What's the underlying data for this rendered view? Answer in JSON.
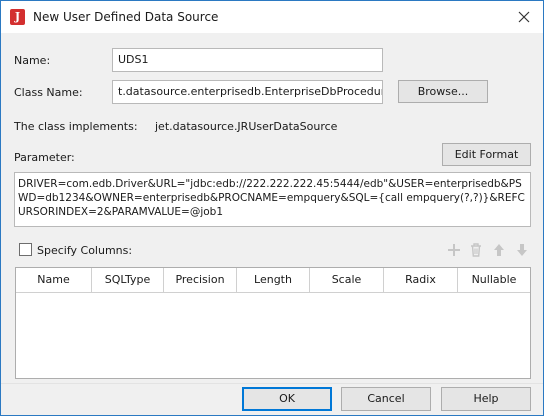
{
  "window": {
    "title": "New User Defined Data Source",
    "icon": "report-app-icon",
    "icon_letter": "J"
  },
  "form": {
    "name_label": "Name:",
    "name_value": "UDS1",
    "class_name_label": "Class Name:",
    "class_name_value": "t.datasource.enterprisedb.EnterpriseDbProcedureUDS",
    "browse_label": "Browse...",
    "implements_label": "The class implements:",
    "implements_value": "jet.datasource.JRUserDataSource",
    "parameter_label": "Parameter:",
    "edit_format_label": "Edit Format",
    "parameter_value": "DRIVER=com.edb.Driver&URL=\"jdbc:edb://222.222.222.45:5444/edb\"&USER=enterprisedb&PSWD=db1234&OWNER=enterprisedb&PROCNAME=empquery&SQL={call empquery(?,?)}&REFCURSORINDEX=2&PARAMVALUE=@job1",
    "specify_columns_label": "Specify Columns:",
    "specify_columns_checked": false
  },
  "columns_toolbar": [
    "add-icon",
    "delete-icon",
    "move-up-icon",
    "move-down-icon"
  ],
  "table": {
    "headers": [
      "Name",
      "SQLType",
      "Precision",
      "Length",
      "Scale",
      "Radix",
      "Nullable"
    ]
  },
  "buttons": {
    "ok": "OK",
    "cancel": "Cancel",
    "help": "Help"
  },
  "colors": {
    "accent": "#0078d7",
    "window_border": "#2b79c2",
    "icon_red": "#d32f2f"
  }
}
